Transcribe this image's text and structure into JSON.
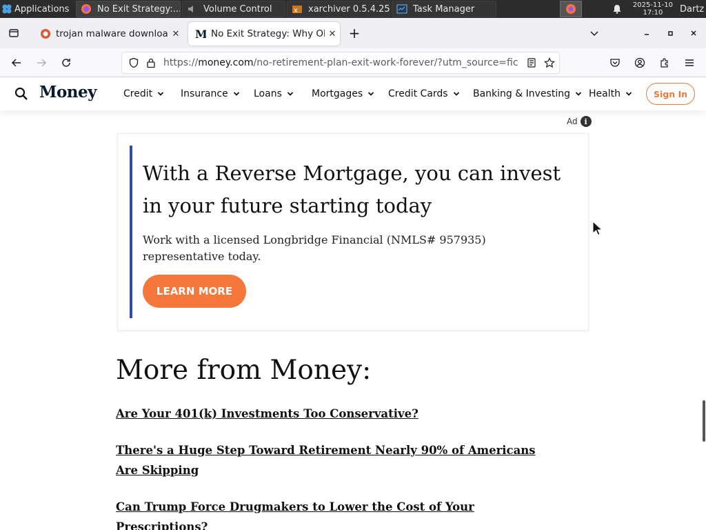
{
  "taskbar": {
    "apps_label": "Applications",
    "tasks": [
      {
        "label": "No Exit Strategy:..."
      },
      {
        "label": "Volume Control"
      },
      {
        "label": "xarchiver 0.5.4.25"
      },
      {
        "label": "Task Manager"
      }
    ],
    "clock_date": "2025-11-10",
    "clock_time": "17:10",
    "user": "Dartz"
  },
  "tabs": [
    {
      "label": "trojan malware downloac"
    },
    {
      "label": "No Exit Strategy: Why Ol"
    }
  ],
  "address": {
    "scheme": "https://",
    "host": "money.com",
    "path": "/no-retirement-plan-exit-work-forever/?utm_source=fic"
  },
  "site": {
    "brand": "Money",
    "nav": [
      "Credit",
      "Insurance",
      "Loans",
      "Mortgages",
      "Credit Cards",
      "Banking & Investing",
      "Health"
    ],
    "signin": "Sign In"
  },
  "ad": {
    "label": "Ad",
    "info": "i",
    "title": "With a Reverse Mortgage, you can invest in your future starting today",
    "text": "Work with a licensed Longbridge Financial (NMLS# 957935) representative today.",
    "button": "LEARN MORE"
  },
  "more": {
    "heading": "More from Money:",
    "links": [
      "Are Your 401(k) Investments Too Conservative?",
      "There's a Huge Step Toward Retirement Nearly 90% of Americans Are Skipping",
      "Can Trump Force Drugmakers to Lower the Cost of Your Prescriptions?"
    ]
  },
  "colors": {
    "accent": "#f4773b",
    "ad_bar": "#2e4fa8",
    "brand": "#0b1a2e"
  }
}
